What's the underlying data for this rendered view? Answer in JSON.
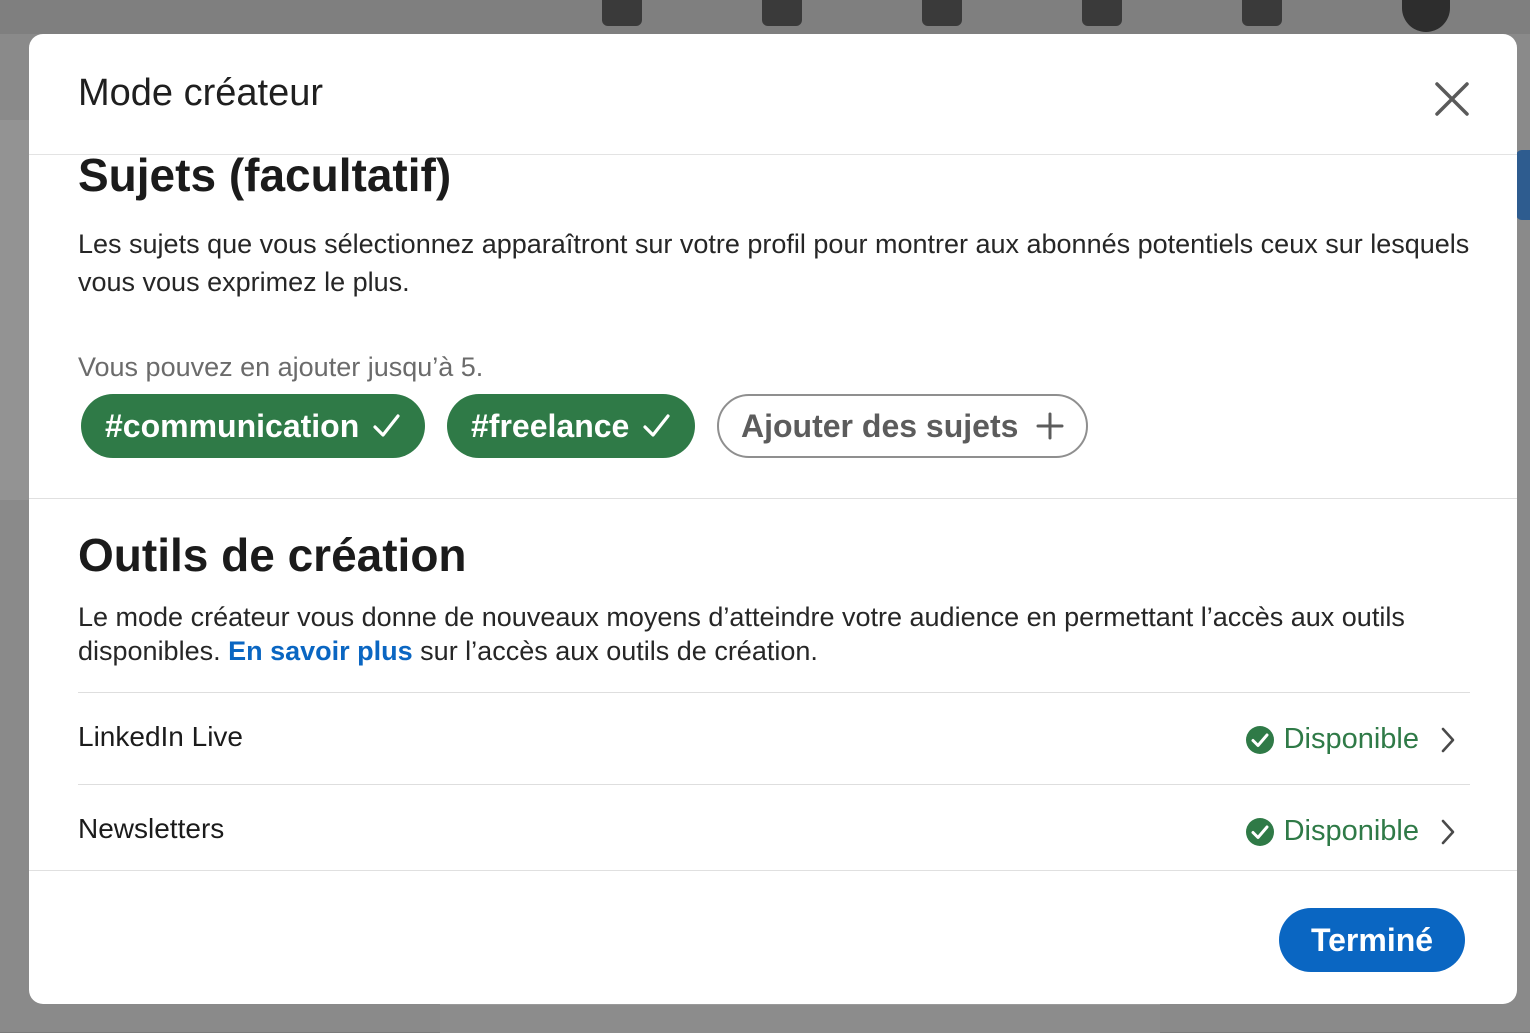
{
  "modal": {
    "title": "Mode créateur",
    "close_icon": "close-icon"
  },
  "topics": {
    "heading": "Sujets (facultatif)",
    "description": "Les sujets que vous sélectionnez apparaîtront sur votre profil pour montrer aux abonnés potentiels ceux sur lesquels vous vous exprimez le plus.",
    "limit_hint": "Vous pouvez en ajouter jusqu’à 5.",
    "selected": [
      {
        "label": "#communication",
        "icon": "checkmark-icon"
      },
      {
        "label": "#freelance",
        "icon": "checkmark-icon"
      }
    ],
    "add_button": {
      "label": "Ajouter des sujets",
      "icon": "plus-icon"
    }
  },
  "tools": {
    "heading": "Outils de création",
    "description_before": "Le mode créateur vous donne de nouveaux moyens d’atteindre votre audience en permettant l’accès aux outils disponibles. ",
    "learn_more": "En savoir plus",
    "description_after": " sur l’accès aux outils de création.",
    "items": [
      {
        "name": "LinkedIn Live",
        "status": "Disponible",
        "status_icon": "check-circle-icon"
      },
      {
        "name": "Newsletters",
        "status": "Disponible",
        "status_icon": "check-circle-icon"
      }
    ]
  },
  "footer": {
    "done_label": "Terminé"
  },
  "colors": {
    "accent_blue": "#0a66c2",
    "success_green": "#2f7a47"
  }
}
